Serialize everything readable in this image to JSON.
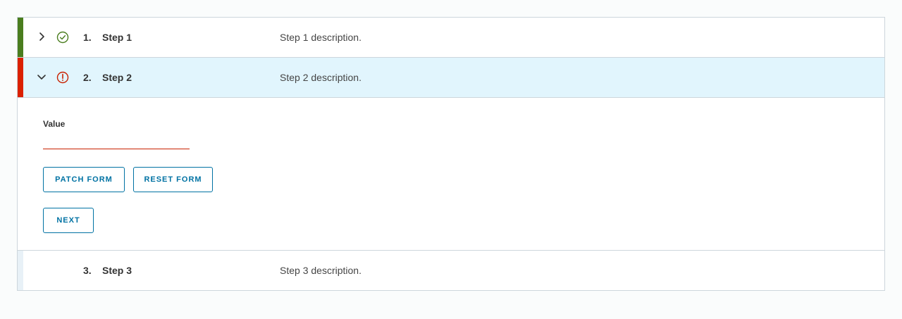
{
  "steps": [
    {
      "number": "1.",
      "title": "Step 1",
      "description": "Step 1 description.",
      "status": "complete",
      "status_icon": "check-circle-icon",
      "expanded": false,
      "chevron_icon": "chevron-right-icon"
    },
    {
      "number": "2.",
      "title": "Step 2",
      "description": "Step 2 description.",
      "status": "error",
      "status_icon": "exclamation-circle-icon",
      "expanded": true,
      "chevron_icon": "chevron-down-icon",
      "form": {
        "field_label": "Value",
        "field_value": "",
        "patch_label": "PATCH FORM",
        "reset_label": "RESET FORM",
        "next_label": "NEXT"
      }
    },
    {
      "number": "3.",
      "title": "Step 3",
      "description": "Step 3 description.",
      "status": "not-started",
      "expanded": false
    }
  ],
  "colors": {
    "complete": "#4a7d1e",
    "error": "#db2100",
    "active_header_bg": "#e1f5fd",
    "button_accent": "#0072a3"
  }
}
